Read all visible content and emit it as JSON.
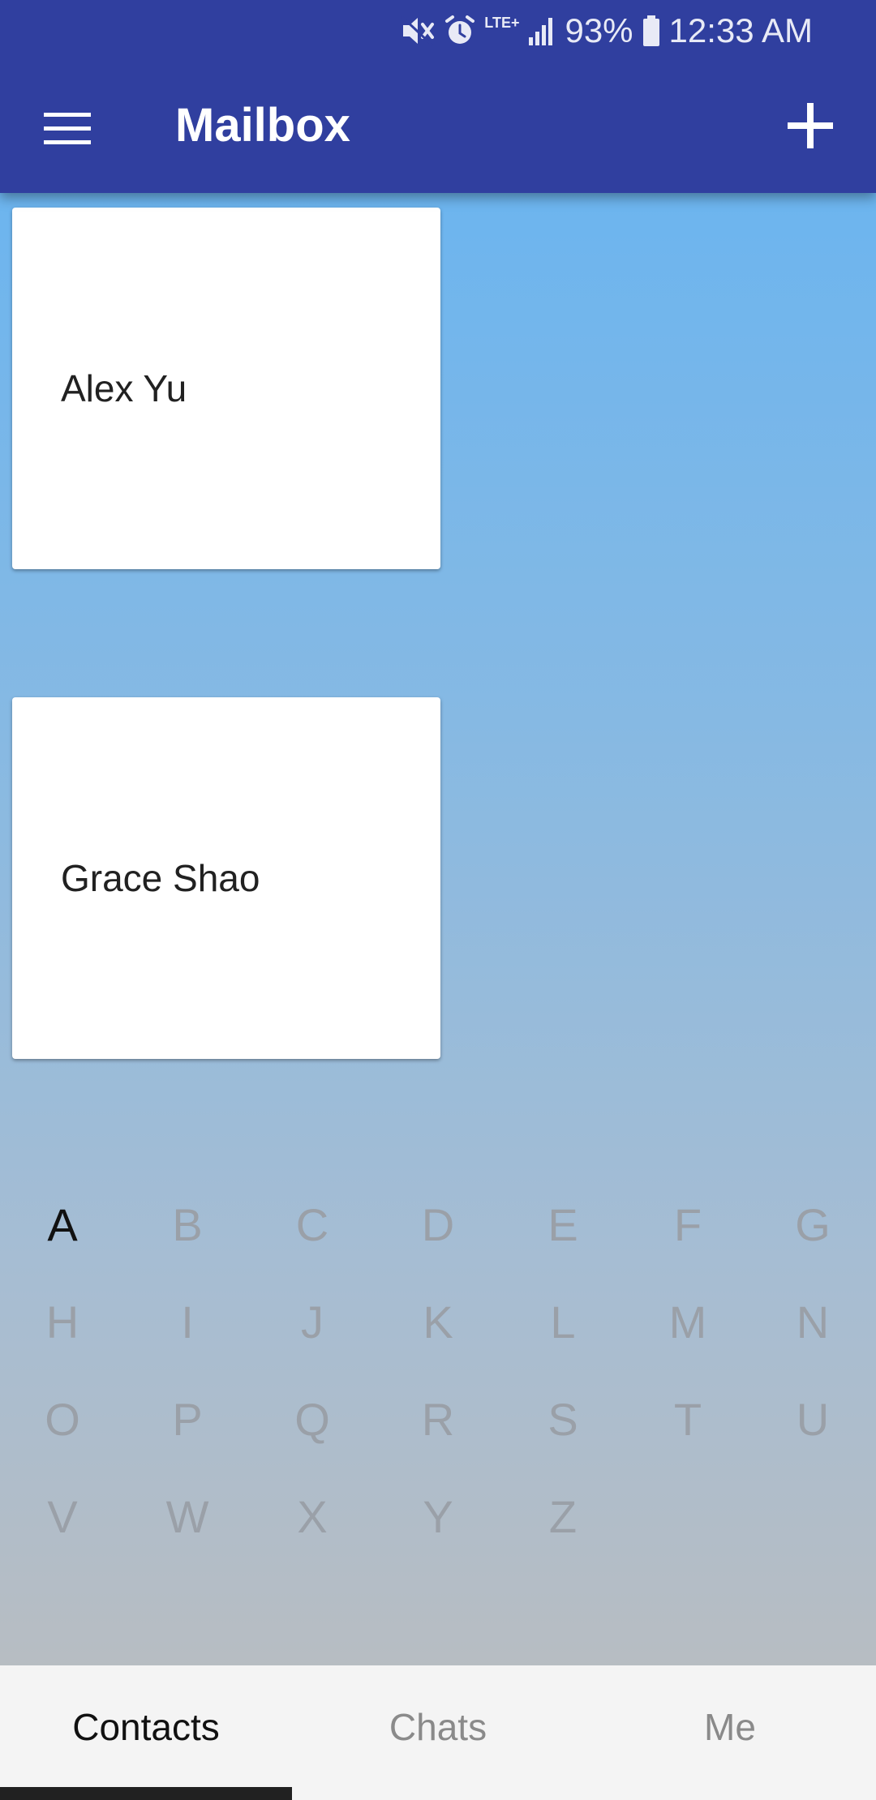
{
  "status_bar": {
    "battery_percent": "93%",
    "time": "12:33 AM",
    "network": "LTE+",
    "icons": [
      "mute-icon",
      "alarm-icon",
      "lte-icon",
      "signal-icon",
      "battery-icon"
    ]
  },
  "header": {
    "title": "Mailbox",
    "menu_icon": "hamburger-menu-icon",
    "add_icon": "plus-icon"
  },
  "contacts": [
    {
      "name": "Alex Yu"
    },
    {
      "name": "Grace Shao"
    }
  ],
  "alphabet": {
    "letters": [
      "A",
      "B",
      "C",
      "D",
      "E",
      "F",
      "G",
      "H",
      "I",
      "J",
      "K",
      "L",
      "M",
      "N",
      "O",
      "P",
      "Q",
      "R",
      "S",
      "T",
      "U",
      "V",
      "W",
      "X",
      "Y",
      "Z"
    ],
    "selected": "A"
  },
  "tabs": [
    {
      "label": "Contacts",
      "active": true
    },
    {
      "label": "Chats",
      "active": false
    },
    {
      "label": "Me",
      "active": false
    }
  ],
  "colors": {
    "app_bar": "#303f9f",
    "card": "#ffffff",
    "letter_inactive": "#9aa0a8",
    "letter_active": "#111111"
  }
}
